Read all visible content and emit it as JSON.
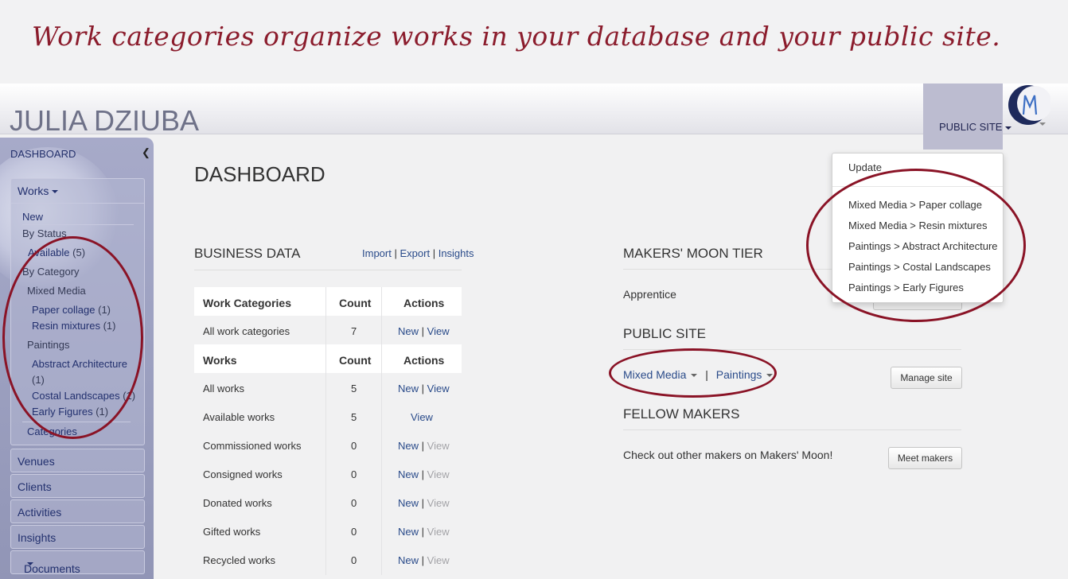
{
  "caption": "Work categories organize works in your database and your public site.",
  "header": {
    "brand": "JULIA DZIUBA",
    "public_site": "PUBLIC SITE"
  },
  "sidebar": {
    "dashboard": "DASHBOARD",
    "works": "Works",
    "new": "New",
    "by_status": "By Status",
    "available": "Available",
    "available_count": "(5)",
    "by_category": "By Category",
    "mixed_media": "Mixed Media",
    "paper_collage": "Paper collage",
    "paper_collage_count": "(1)",
    "resin_mixtures": "Resin mixtures",
    "resin_mixtures_count": "(1)",
    "paintings": "Paintings",
    "abstract_architecture": "Abstract Architecture",
    "abstract_architecture_count": "(1)",
    "costal_landscapes": "Costal Landscapes",
    "costal_landscapes_count": "(1)",
    "early_figures": "Early Figures",
    "early_figures_count": "(1)",
    "categories": "Categories",
    "venues": "Venues",
    "clients": "Clients",
    "activities": "Activities",
    "insights": "Insights",
    "documents": "Documents"
  },
  "main": {
    "title": "DASHBOARD",
    "business_data": "BUSINESS DATA",
    "import": "Import",
    "export": "Export",
    "insights": "Insights",
    "pipe": "|",
    "table1": {
      "headers": [
        "Work Categories",
        "Count",
        "Actions"
      ],
      "rows": [
        {
          "label": "All work categories",
          "count": "7",
          "new": "New",
          "view": "View"
        }
      ]
    },
    "table2": {
      "headers": [
        "Works",
        "Count",
        "Actions"
      ],
      "rows": [
        {
          "label": "All works",
          "count": "5",
          "new": "New",
          "view": "View"
        },
        {
          "label": "Available works",
          "count": "5",
          "view": "View"
        },
        {
          "label": "Commissioned works",
          "count": "0",
          "new": "New",
          "view": "View"
        },
        {
          "label": "Consigned works",
          "count": "0",
          "new": "New",
          "view": "View"
        },
        {
          "label": "Donated works",
          "count": "0",
          "new": "New",
          "view": "View"
        },
        {
          "label": "Gifted works",
          "count": "0",
          "new": "New",
          "view": "View"
        },
        {
          "label": "Recycled works",
          "count": "0",
          "new": "New",
          "view": "View"
        }
      ]
    },
    "tier_title": "MAKERS' MOON TIER",
    "tier_value": "Apprentice",
    "public_site_title": "PUBLIC SITE",
    "ps_mixed_media": "Mixed Media",
    "ps_paintings": "Paintings",
    "manage_site": "Manage site",
    "fellow_title": "FELLOW MAKERS",
    "fellow_text": "Check out other makers on Makers' Moon!",
    "meet_makers": "Meet makers"
  },
  "dropdown": {
    "update": "Update",
    "items": [
      "Mixed Media > Paper collage",
      "Mixed Media > Resin mixtures",
      "Paintings > Abstract Architecture",
      "Paintings > Costal Landscapes",
      "Paintings > Early Figures"
    ]
  },
  "colors": {
    "accent": "#8b1c2c",
    "link": "#2a4b8a",
    "sidebar": "#9ea2c2"
  }
}
